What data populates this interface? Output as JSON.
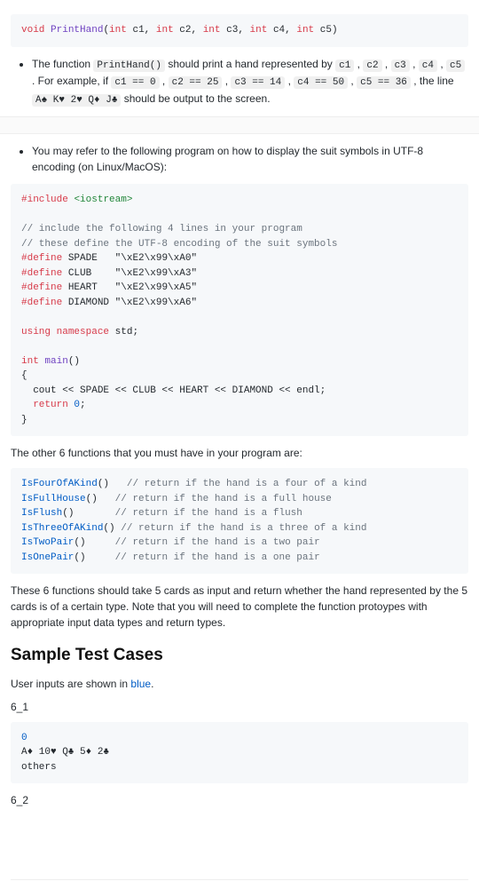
{
  "sig": {
    "void": "void",
    "fn": "PrintHand",
    "int": "int",
    "p1": "c1",
    "p2": "c2",
    "p3": "c3",
    "p4": "c4",
    "p5": "c5"
  },
  "bullet1": {
    "t1": "The function ",
    "code_fn": "PrintHand()",
    "t2": " should print a hand represented by ",
    "c1": "c1",
    "c2": "c2",
    "c3": "c3",
    "c4": "c4",
    "c5": "c5",
    "t3": " . For example, if ",
    "eq1": "c1 == 0",
    "eq2": "c2 == 25",
    "eq3": "c3 == 14",
    "eq4": "c4 == 50",
    "eq5": "c5 == 36",
    "t4": " , the line ",
    "hand": "A♠ K♥ 2♥ Q♦ J♣",
    "t5": " should be output to the screen.",
    "comma": " , "
  },
  "bullet2": {
    "t1": "You may refer to the following program on how to display the suit symbols in UTF-8 encoding (on Linux/MacOS):"
  },
  "prog": {
    "inc_hash": "#",
    "inc_kw": "include",
    "inc_hdr": "<iostream>",
    "c1": "// include the following 4 lines in your program",
    "c2": "// these define the UTF-8 encoding of the suit symbols",
    "def_hash": "#",
    "def_kw": "define",
    "d1_name": "SPADE   ",
    "d1_val": "\"\\xE2\\x99\\xA0\"",
    "d2_name": "CLUB    ",
    "d2_val": "\"\\xE2\\x99\\xA3\"",
    "d3_name": "HEART   ",
    "d3_val": "\"\\xE2\\x99\\xA5\"",
    "d4_name": "DIAMOND ",
    "d4_val": "\"\\xE2\\x99\\xA6\"",
    "using": "using",
    "ns": "namespace",
    "std": "std;",
    "int": "int",
    "main": "main",
    "parens": "()",
    "ob": "{",
    "cout_line_a": "  cout << SPADE << CLUB << HEART << DIAMOND << endl;",
    "ret": "return",
    "zero": "0",
    "semi": ";",
    "cb": "}"
  },
  "para1": {
    "t1": "The other 6 functions that you must have in your program are:"
  },
  "funcs": {
    "f1": "IsFourOfAKind",
    "f2": "IsFullHouse",
    "f3": "IsFlush",
    "f4": "IsThreeOfAKind",
    "f5": "IsTwoPair",
    "f6": "IsOnePair",
    "empty": "()",
    "pad1": "   ",
    "pad2": "   ",
    "pad3": "       ",
    "pad4": " ",
    "pad5": "     ",
    "pad6": "     ",
    "c1": "// return if the hand is a four of a kind",
    "c2": "// return if the hand is a full house",
    "c3": "// return if the hand is a flush",
    "c4": "// return if the hand is a three of a kind",
    "c5": "// return if the hand is a two pair",
    "c6": "// return if the hand is a one pair"
  },
  "para2": {
    "t1": "These 6 functions should take 5 cards as input and return whether the hand represented by the 5 cards is of a certain type. Note that you will need to complete the function protoypes with appropriate input data types and return types."
  },
  "heading": "Sample Test Cases",
  "para3": {
    "t1": "User inputs are shown in ",
    "blue": "blue",
    "t2": "."
  },
  "tc1_label": "6_1",
  "tc1": {
    "in": "0",
    "l1": "A♦ 10♥ Q♣ 5♦ 2♣",
    "l2": "others"
  },
  "tc2_label": "6_2"
}
